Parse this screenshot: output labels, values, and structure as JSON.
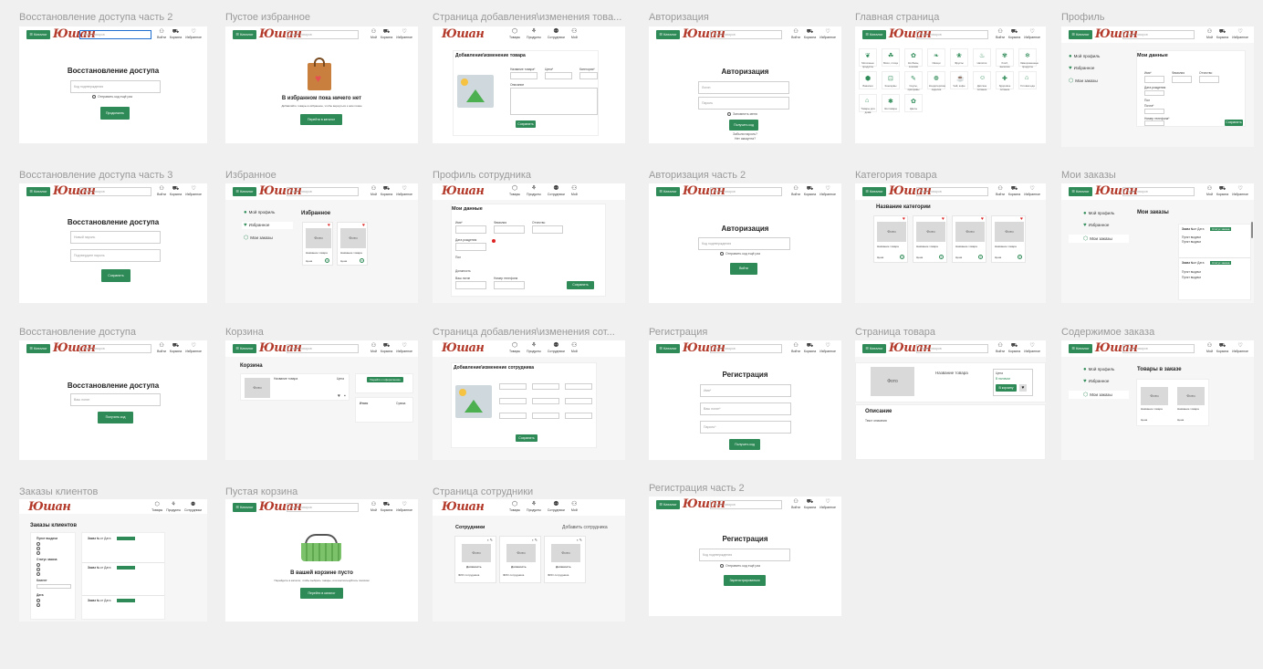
{
  "header": {
    "catalog": "☰ Каталог",
    "logo": "Юшан",
    "search_placeholder": "Поиск товаров",
    "login": "Войти",
    "cart": "Корзина",
    "favorites": "Избранное",
    "products": "Товары",
    "orders": "Продукты",
    "employees": "Сотрудники",
    "me": "Мой"
  },
  "frames": {
    "recover2": {
      "title": "Восстановление доступа часть 2",
      "heading": "Восстановление доступа",
      "code_placeholder": "Код подтверждения",
      "resend": "Отправить код ещё раз",
      "button": "Продолжить"
    },
    "empty_fav": {
      "title": "Пустое избранное",
      "heading": "В избранном пока ничего нет",
      "sub": "Добавляйте товары в избранное, чтобы вернуться к ним позже",
      "button": "Перейти в каталог"
    },
    "product_edit": {
      "title": "Страница добавления\\изменения това...",
      "heading": "Добавление\\изменение товара",
      "f1": "Название товара*",
      "f2": "Цена*",
      "f3": "Категория*",
      "f4": "Описание",
      "button": "Сохранить"
    },
    "auth": {
      "title": "Авторизация",
      "heading": "Авторизация",
      "login_ph": "Логин",
      "pass_ph": "Пароль",
      "remember": "Запомнить меня",
      "button": "Получить код",
      "forgot": "Забыли пароль?",
      "noacc": "Нет аккаунта?"
    },
    "main": {
      "title": "Главная страница",
      "cats": [
        "Молочные продукты",
        "Мясо, птица",
        "Колбасы, сосиски",
        "Овощи",
        "Фрукты",
        "Напитки",
        "Хлеб, выпечка",
        "Замороженные продукты",
        "Бакалея",
        "Консервы",
        "Соусы, приправы",
        "Кондитерские изделия",
        "Чай, кофе",
        "Детское питание",
        "Здоровое питание",
        "Готовая еда",
        "Товары для дома",
        "Зоотовары",
        "Цветы"
      ]
    },
    "profile": {
      "title": "Профиль",
      "menu": [
        "Мой профиль",
        "Избранное",
        "Мои заказы"
      ],
      "heading": "Мои данные",
      "f": [
        "Имя*",
        "Фамилия",
        "Отчество",
        "Дата рождения",
        "Пол",
        "Почта*",
        "Номер телефона*"
      ],
      "button": "Сохранить"
    },
    "recover3": {
      "title": "Восстановление доступа часть 3",
      "heading": "Восстановление доступа",
      "new_pass": "Новый пароль",
      "repeat_pass": "Подтвердите пароль",
      "button": "Сохранить"
    },
    "favorites": {
      "title": "Избранное",
      "menu": [
        "Мой профиль",
        "Избранное",
        "Мои заказы"
      ],
      "heading": "Избранное",
      "photo": "Фото",
      "item": "Название товара",
      "price": "Цена"
    },
    "emp_profile": {
      "title": "Профиль сотрудника",
      "heading": "Мои данные",
      "f": [
        "Имя*",
        "Фамилия",
        "Отчество",
        "Дата рождения",
        "Пол",
        "Должность",
        "Ваш логин",
        "Номер телефона"
      ],
      "button": "Сохранить"
    },
    "auth2": {
      "title": "Авторизация часть 2",
      "heading": "Авторизация",
      "code_placeholder": "Код подтверждения",
      "resend": "Отправить код ещё раз",
      "button": "Войти"
    },
    "category": {
      "title": "Категория товара",
      "heading": "Название категории",
      "photo": "Фото",
      "item": "Название товара",
      "price": "Цена"
    },
    "my_orders": {
      "title": "Мои заказы",
      "menu": [
        "Мой профиль",
        "Избранное",
        "Мои заказы"
      ],
      "heading": "Мои заказы",
      "order": "Заказ №",
      "date": "от Дата",
      "status": "Статус заказа",
      "l1": "Пункт выдачи",
      "l2": "Пункт выдачи"
    },
    "recover": {
      "title": "Восстановление доступа",
      "heading": "Восстановление доступа",
      "login_ph": "Ваш логин",
      "button": "Получить код"
    },
    "cart": {
      "title": "Корзина",
      "heading": "Корзина",
      "photo": "Фото",
      "item": "Название товара",
      "price": "Цена",
      "checkout": "Перейти к оформлению",
      "total": "Итого",
      "sum": "Сумма"
    },
    "emp_edit": {
      "title": "Страница добавления\\изменения сот...",
      "heading": "Добавление\\изменение сотрудника",
      "button": "Сохранить"
    },
    "register": {
      "title": "Регистрация",
      "heading": "Регистрация",
      "name": "Имя*",
      "login": "Ваш логин*",
      "pass": "Пароль*",
      "button": "Получить код"
    },
    "product": {
      "title": "Страница товара",
      "photo": "Фото",
      "name": "Название товара",
      "price": "Цена",
      "in_stock": "В наличии",
      "button": "В корзину",
      "desc": "Описание",
      "desc_text": "Текст описания"
    },
    "order_content": {
      "title": "Содержимое заказа",
      "menu": [
        "Мой профиль",
        "Избранное",
        "Мои заказы"
      ],
      "heading": "Товары в заказе",
      "photo": "Фото",
      "item": "Название товара",
      "price": "Цена"
    },
    "client_orders": {
      "title": "Заказы клиентов",
      "heading": "Заказы клиентов",
      "filters": [
        "Пункт выдачи",
        "Статус заказа",
        "Клиент",
        "Дата"
      ],
      "order": "Заказ №",
      "date": "от Дата"
    },
    "empty_cart": {
      "title": "Пустая корзина",
      "heading": "В вашей корзине пусто",
      "sub": "Перейдите в каталог, чтобы выбрать товары, или воспользуйтесь поиском",
      "button": "Перейти в каталог"
    },
    "employees": {
      "title": "Страница сотрудники",
      "heading": "Сотрудники",
      "add": "Добавить сотрудника",
      "photo": "Фото",
      "role": "Должность",
      "name": "ФИО сотрудника"
    },
    "register2": {
      "title": "Регистрация часть 2",
      "heading": "Регистрация",
      "code_placeholder": "Код подтверждения",
      "resend": "Отправить код ещё раз",
      "button": "Зарегистрироваться"
    }
  },
  "colors": {
    "accent": "#2e8b57",
    "logo": "#b33a2a",
    "canvas": "#f0f0f0"
  }
}
